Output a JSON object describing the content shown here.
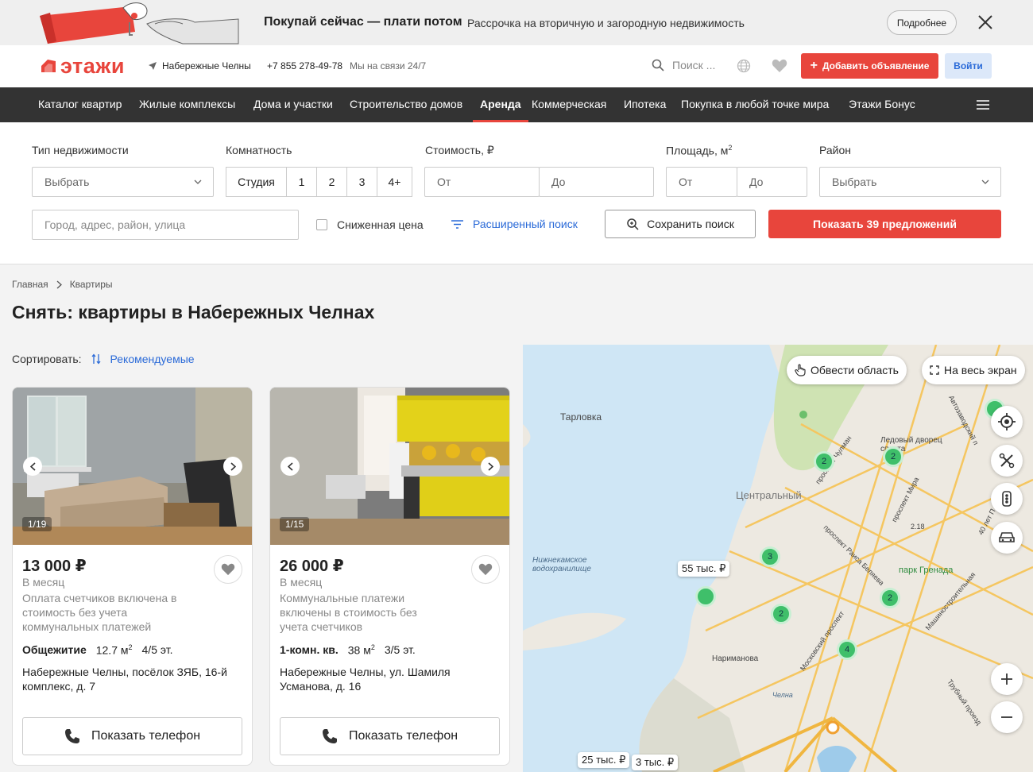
{
  "promo": {
    "title": "Покупай сейчас — плати потом",
    "subtitle": "Рассрочка на вторичную и загородную недвижимость",
    "more_label": "Подробнее"
  },
  "header": {
    "logo_text": "этажи",
    "city": "Набережные Челны",
    "phone": "+7 855 278-49-78",
    "support": "Мы на связи 24/7",
    "search_placeholder": "Поиск ...",
    "add_listing_label": "Добавить объявление",
    "login_label": "Войти"
  },
  "nav": {
    "items": [
      "Каталог квартир",
      "Жилые комплексы",
      "Дома и участки",
      "Строительство домов",
      "Аренда",
      "Коммерческая",
      "Ипотека",
      "Покупка в любой точке мира",
      "Этажи Бонус"
    ],
    "active": "Аренда"
  },
  "filters": {
    "type_label": "Тип недвижимости",
    "type_value": "Выбрать",
    "rooms_label": "Комнатность",
    "rooms": [
      "Студия",
      "1",
      "2",
      "3",
      "4+"
    ],
    "price_label": "Стоимость, ₽",
    "price_from": "От",
    "price_to": "До",
    "area_label": "Площадь, м",
    "area_sup": "2",
    "area_from": "От",
    "area_to": "До",
    "district_label": "Район",
    "district_value": "Выбрать",
    "address_placeholder": "Город, адрес, район, улица",
    "reduced_label": "Сниженная цена",
    "advanced_label": "Расширенный поиск",
    "save_label": "Сохранить поиск",
    "show_label": "Показать 39 предложений"
  },
  "breadcrumbs": [
    "Главная",
    "Квартиры"
  ],
  "page_title": "Снять: квартиры в Набережных Челнах",
  "sort": {
    "label": "Сортировать:",
    "value": "Рекомендуемые"
  },
  "cards": [
    {
      "counter": "1/19",
      "price": "13 000 ₽",
      "period": "В месяц",
      "note": "Оплата счетчиков включена в стоимость без учета коммунальных платежей",
      "type": "Общежитие",
      "area": "12.7 м",
      "area_sup": "2",
      "floor": "4/5 эт.",
      "address": "Набережные Челны, посёлок ЗЯБ, 16-й комплекс, д. 7",
      "phone_label": "Показать телефон"
    },
    {
      "counter": "1/15",
      "price": "26 000 ₽",
      "period": "В месяц",
      "note": "Коммунальные платежи включены в стоимость без учета счетчиков",
      "type": "1-комн. кв.",
      "area": "38 м",
      "area_sup": "2",
      "floor": "3/5 эт.",
      "address": "Набережные Челны, ул. Шамиля Усманова, д. 16",
      "phone_label": "Показать телефон"
    }
  ],
  "map": {
    "draw_area_label": "Обвести область",
    "fullscreen_label": "На весь экран",
    "labels": [
      "Тарловка",
      "Центральный",
      "Нижнекамское водохранилище",
      "Ледовый дворец спорта",
      "парк Гренада",
      "Нариманова",
      "проспект Чулман",
      "проспект Мира",
      "проспект Раиса Беляева",
      "Московский проспект",
      "Машиностроительная",
      "Трубный проезд",
      "Автозаводский п",
      "40 лет П",
      "2.18",
      "Челна"
    ],
    "price_pins": [
      "55 тыс. ₽",
      "25 тыс. ₽",
      "3 тыс. ₽"
    ],
    "clusters": [
      "2",
      "2",
      "3",
      "2",
      "2",
      "4"
    ]
  }
}
